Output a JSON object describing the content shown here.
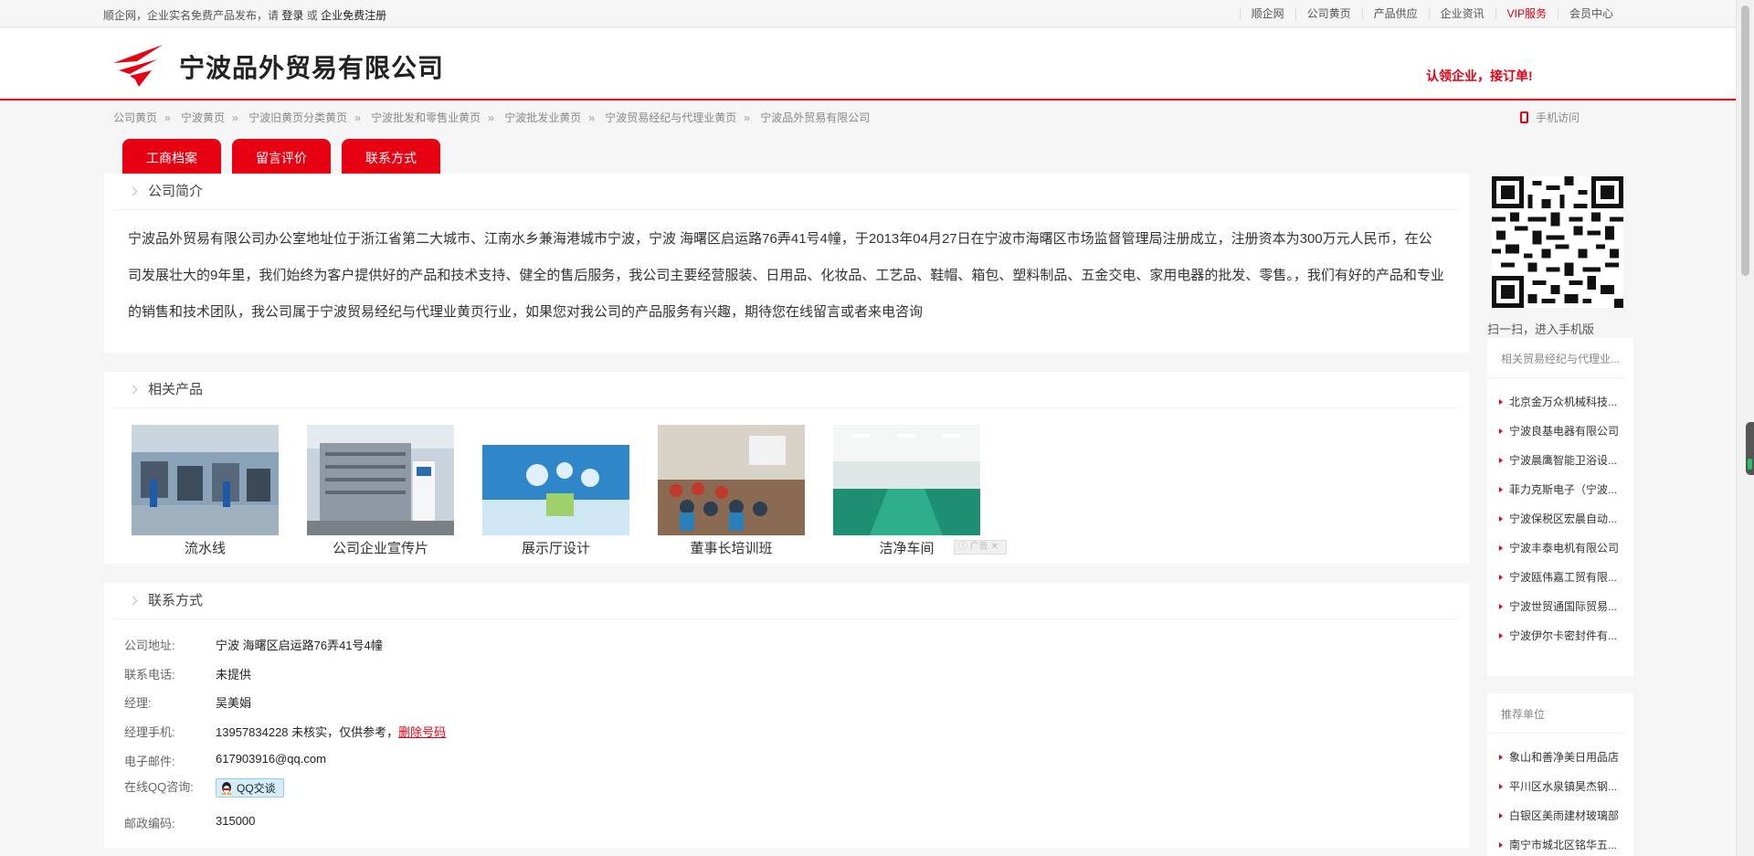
{
  "topbar": {
    "left_text_1": "顺企网，企业实名免费产品发布，请",
    "login": "登录",
    "or": "或",
    "register": "企业免费注册",
    "links": [
      "顺企网",
      "公司黄页",
      "产品供应",
      "企业资讯",
      "VIP服务",
      "会员中心"
    ]
  },
  "header": {
    "company_name": "宁波品外贸易有限公司",
    "slogan": "认领企业，接订单!"
  },
  "breadcrumb": [
    "公司黄页",
    "宁波黄页",
    "宁波旧黄页分类黄页",
    "宁波批发和零售业黄页",
    "宁波批发业黄页",
    "宁波贸易经纪与代理业黄页",
    "宁波品外贸易有限公司"
  ],
  "breadcrumb_sep": "»",
  "mobile_visit": "手机访问",
  "tabs": [
    "工商档案",
    "留言评价",
    "联系方式"
  ],
  "intro": {
    "title": "公司简介",
    "text": "宁波品外贸易有限公司办公室地址位于浙江省第二大城市、江南水乡兼海港城市宁波，宁波 海曙区启运路76弄41号4幢，于2013年04月27日在宁波市海曙区市场监督管理局注册成立，注册资本为300万元人民币，在公司发展壮大的9年里，我们始终为客户提供好的产品和技术支持、健全的售后服务，我公司主要经营服装、日用品、化妆品、工艺品、鞋帽、箱包、塑料制品、五金交电、家用电器的批发、零售。，我们有好的产品和专业的销售和技术团队，我公司属于宁波贸易经纪与代理业黄页行业，如果您对我公司的产品服务有兴趣，期待您在线留言或者来电咨询"
  },
  "products": {
    "title": "相关产品",
    "items": [
      {
        "caption": "流水线"
      },
      {
        "caption": "公司企业宣传片"
      },
      {
        "caption": "展示厅设计"
      },
      {
        "caption": "董事长培训班"
      },
      {
        "caption": "洁净车间"
      }
    ],
    "ad_label": "广告"
  },
  "contact": {
    "title": "联系方式",
    "address_label": "公司地址:",
    "address": "宁波 海曙区启运路76弄41号4幢",
    "phone_label": "联系电话:",
    "phone": "未提供",
    "manager_label": "经理:",
    "manager": "吴美娟",
    "mobile_label": "经理手机:",
    "mobile": "13957834228 未核实，仅供参考，",
    "delete_number": "删除号码",
    "email_label": "电子邮件:",
    "email": "617903916@qq.com",
    "qq_label": "在线QQ咨询:",
    "qq_button": "QQ交谈",
    "zip_label": "邮政编码:",
    "zip": "315000"
  },
  "sidebar": {
    "qr_caption": "扫一扫，进入手机版",
    "related_title": "相关贸易经纪与代理业...",
    "related": [
      "北京金万众机械科技...",
      "宁波良基电器有限公司",
      "宁波晨鹰智能卫浴设...",
      "菲力克斯电子（宁波...",
      "宁波保税区宏晨自动...",
      "宁波丰泰电机有限公司",
      "宁波瓯伟嘉工贸有限...",
      "宁波世贸通国际贸易...",
      "宁波伊尔卡密封件有..."
    ],
    "recommend_title": "推荐单位",
    "recommend": [
      "象山和善净美日用品店",
      "平川区水泉镇昊杰钢...",
      "白银区美雨建材玻璃部",
      "南宁市城北区铭华五..."
    ]
  },
  "colors": {
    "brand_red": "#e60012"
  }
}
